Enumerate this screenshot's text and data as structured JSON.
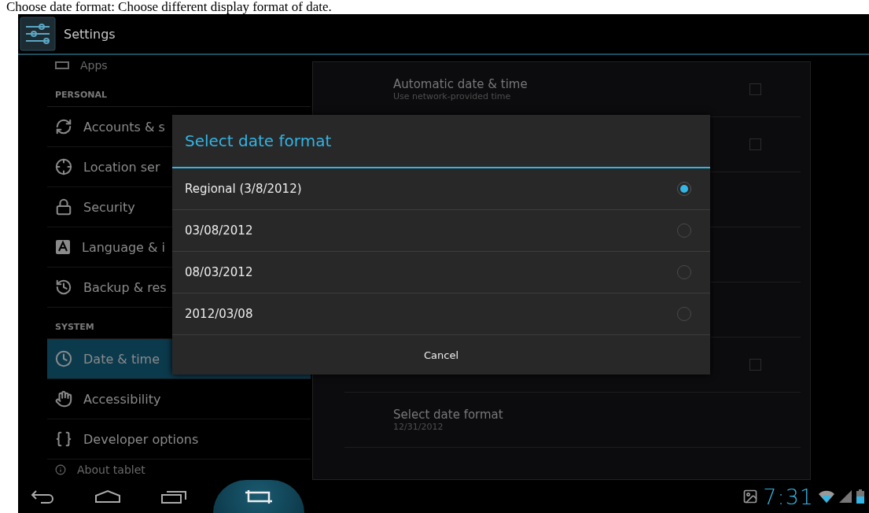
{
  "caption": "Choose date format: Choose different display format of date.",
  "action_bar": {
    "title": "Settings"
  },
  "sidebar": {
    "items": [
      {
        "kind": "partial",
        "label": "Apps",
        "selected": false
      },
      {
        "kind": "header",
        "label": "PERSONAL"
      },
      {
        "kind": "item",
        "label": "Accounts & s",
        "selected": false
      },
      {
        "kind": "item",
        "label": "Location ser",
        "selected": false
      },
      {
        "kind": "item",
        "label": "Security",
        "selected": false
      },
      {
        "kind": "item",
        "label": "Language & i",
        "selected": false
      },
      {
        "kind": "item",
        "label": "Backup & res",
        "selected": false
      },
      {
        "kind": "header",
        "label": "SYSTEM"
      },
      {
        "kind": "item",
        "label": "Date & time",
        "selected": true
      },
      {
        "kind": "item",
        "label": "Accessibility",
        "selected": false
      },
      {
        "kind": "item",
        "label": "Developer options",
        "selected": false
      },
      {
        "kind": "partial",
        "label": "About tablet",
        "selected": false
      }
    ]
  },
  "detail": {
    "rows": [
      {
        "title": "Automatic date & time",
        "summary": "Use network-provided time",
        "checkbox": {
          "checked": false
        }
      },
      {
        "checkbox": {
          "checked": false
        }
      },
      {},
      {},
      {},
      {
        "checkbox": {
          "checked": false
        }
      },
      {
        "title": "Select date format",
        "summary": "12/31/2012"
      }
    ]
  },
  "dialog": {
    "title": "Select date format",
    "options": [
      {
        "label": "Regional (3/8/2012)",
        "selected": true
      },
      {
        "label": "03/08/2012",
        "selected": false
      },
      {
        "label": "08/03/2012",
        "selected": false
      },
      {
        "label": "2012/03/08",
        "selected": false
      }
    ],
    "cancel": "Cancel"
  },
  "status_bar": {
    "time": "7:31"
  }
}
